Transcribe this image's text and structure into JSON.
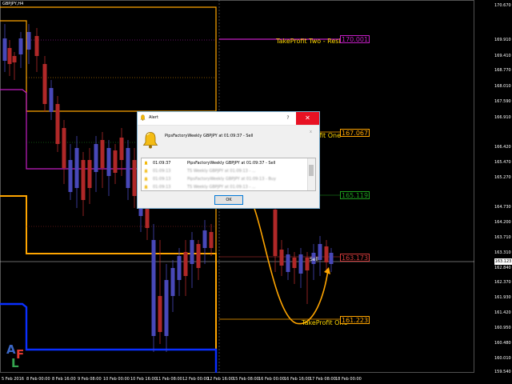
{
  "chart": {
    "title": "GBPJPY,H4",
    "current_price": "163.123",
    "price_ticks": [
      "170.670",
      "169.910",
      "169.410",
      "168.770",
      "168.010",
      "167.590",
      "166.910",
      "166.420",
      "165.470",
      "165.270",
      "164.730",
      "164.200",
      "163.710",
      "163.310",
      "162.840",
      "162.370",
      "161.930",
      "161.420",
      "160.950",
      "160.480",
      "160.010",
      "159.540"
    ],
    "time_ticks": [
      "5 Feb 2016",
      "8 Feb 00:00",
      "8 Feb 16:00",
      "9 Feb 08:00",
      "10 Feb 00:00",
      "10 Feb 16:00",
      "11 Feb 08:00",
      "12 Feb 00:00",
      "12 Feb 16:00",
      "15 Feb 08:00",
      "16 Feb 00:00",
      "16 Feb 16:00",
      "17 Feb 08:00",
      "18 Feb 00:00"
    ]
  },
  "levels": {
    "tp2_label": "TakeProfit Two - Resistance",
    "tp2_price": "170.001",
    "tp1_label_partial": "fit One",
    "tp1_price_upper": "167.067",
    "entry_price": "165.119",
    "sell_label": "Sell",
    "sell_price": "163.173",
    "tp_one_label": "TakeProfit One",
    "tp_one_price": "161.223"
  },
  "logo": {
    "a": "A",
    "f": "F",
    "l": "L"
  },
  "dialog": {
    "title": "Alert",
    "help": "?",
    "close": "✕",
    "message": "PipsFactoryWeekly GBPJPY at 01:09:37 - Sell",
    "x_mark": "x",
    "rows": [
      {
        "time": "01:09:37",
        "text": "PipsFactoryWeekly GBPJPY at 01:09:37 - Sell"
      },
      {
        "time": "01:09:13",
        "text": "TS Weekly GBPJPY at 01:09:13 - ..."
      },
      {
        "time": "01:09:13",
        "text": "PipsFactoryWeekly GBPJPY at 01:09:13 - Buy"
      },
      {
        "time": "01:09:13",
        "text": "TS Weekly GBPJPY at 01:09:13 - ..."
      }
    ],
    "ok": "OK"
  },
  "colors": {
    "bull": "#4848b8",
    "bear": "#b02828",
    "tp2": "#c41ec4",
    "orange": "#ffa500",
    "blue": "#0a2fff",
    "cyan": "#00c0c0",
    "green": "#1e9e1e",
    "red_box": "#d23a3a"
  }
}
